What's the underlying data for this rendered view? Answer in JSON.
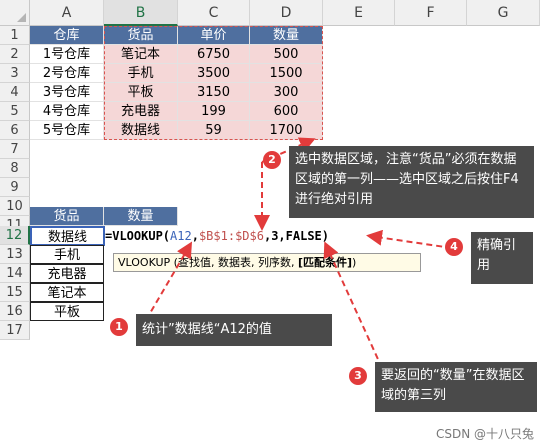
{
  "columns": [
    "A",
    "B",
    "C",
    "D",
    "E",
    "F",
    "G"
  ],
  "rows": [
    "1",
    "2",
    "3",
    "4",
    "5",
    "6",
    "7",
    "8",
    "9",
    "10",
    "11",
    "12",
    "13",
    "14",
    "15",
    "16",
    "17"
  ],
  "table1": {
    "headers": [
      "仓库",
      "货品",
      "单价",
      "数量"
    ],
    "rows": [
      [
        "1号仓库",
        "笔记本",
        "6750",
        "500"
      ],
      [
        "2号仓库",
        "手机",
        "3500",
        "1500"
      ],
      [
        "3号仓库",
        "平板",
        "3150",
        "300"
      ],
      [
        "4号仓库",
        "充电器",
        "199",
        "600"
      ],
      [
        "5号仓库",
        "数据线",
        "59",
        "1700"
      ]
    ]
  },
  "table2": {
    "headers": [
      "货品",
      "数量"
    ],
    "items": [
      "数据线",
      "手机",
      "充电器",
      "笔记本",
      "平板"
    ]
  },
  "formula": {
    "start": "=VLOOKUP(",
    "arg1": "A12",
    "sep1": ",",
    "arg2": "$B$1:$D$6",
    "rest": ",3,FALSE)"
  },
  "tooltip": {
    "text": "VLOOKUP (查找值, 数据表, 列序数, ",
    "bold": "[匹配条件]",
    "end": ")"
  },
  "callouts": {
    "c1": {
      "num": "1",
      "text": "统计”数据线“A12的值"
    },
    "c2": {
      "num": "2",
      "text": "选中数据区域，注意“货品”必须在数据区域的第一列——选中区域之后按住F4进行绝对引用"
    },
    "c3": {
      "num": "3",
      "text": "要返回的“数量”在数据区域的第三列"
    },
    "c4": {
      "num": "4",
      "text": "精确引用"
    }
  },
  "watermark": "CSDN @十八只兔",
  "colors": {
    "header_blue": "#4f6f9f",
    "pink": "#f5d7d7",
    "callout_bg": "#4a4a4a",
    "badge": "#e23b3b",
    "arrow": "#e23b3b"
  }
}
